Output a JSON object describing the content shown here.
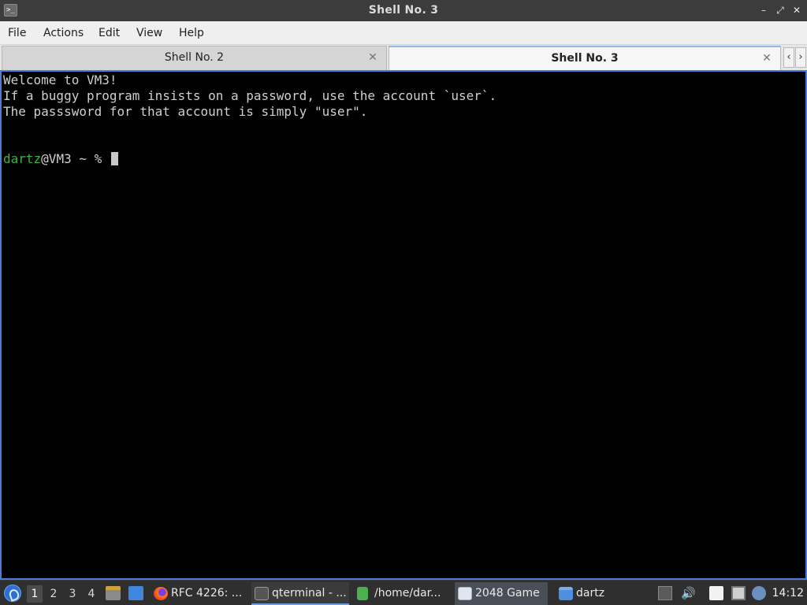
{
  "window": {
    "title": "Shell No. 3",
    "controls": {
      "minimize": "–",
      "restore": "⤢",
      "close": "✕"
    }
  },
  "menu": [
    "File",
    "Actions",
    "Edit",
    "View",
    "Help"
  ],
  "tabs": [
    {
      "label": "Shell No. 2",
      "active": false
    },
    {
      "label": "Shell No. 3",
      "active": true
    }
  ],
  "terminal": {
    "lines": [
      "Welcome to VM3!",
      "If a buggy program insists on a password, use the account `user`.",
      "The passsword for that account is simply \"user\"."
    ],
    "prompt": {
      "user": "dartz",
      "rest": "@VM3 ~ % "
    }
  },
  "taskbar": {
    "workspaces": [
      "1",
      "2",
      "3",
      "4"
    ],
    "active_workspace": "1",
    "tasks": [
      {
        "label": "RFC 4226: ...",
        "icon": "firefox-icon"
      },
      {
        "label": "qterminal - ...",
        "icon": "terminal-icon"
      },
      {
        "label": "/home/dar...",
        "icon": "text-editor-icon"
      },
      {
        "label": "2048 Game",
        "icon": "window-icon"
      },
      {
        "label": "dartz",
        "icon": "folder-icon"
      }
    ],
    "clock": "14:12"
  },
  "colors": {
    "terminal_bg": "#000000",
    "prompt_user": "#3fb33f",
    "focus_border": "#4a7ed8"
  }
}
